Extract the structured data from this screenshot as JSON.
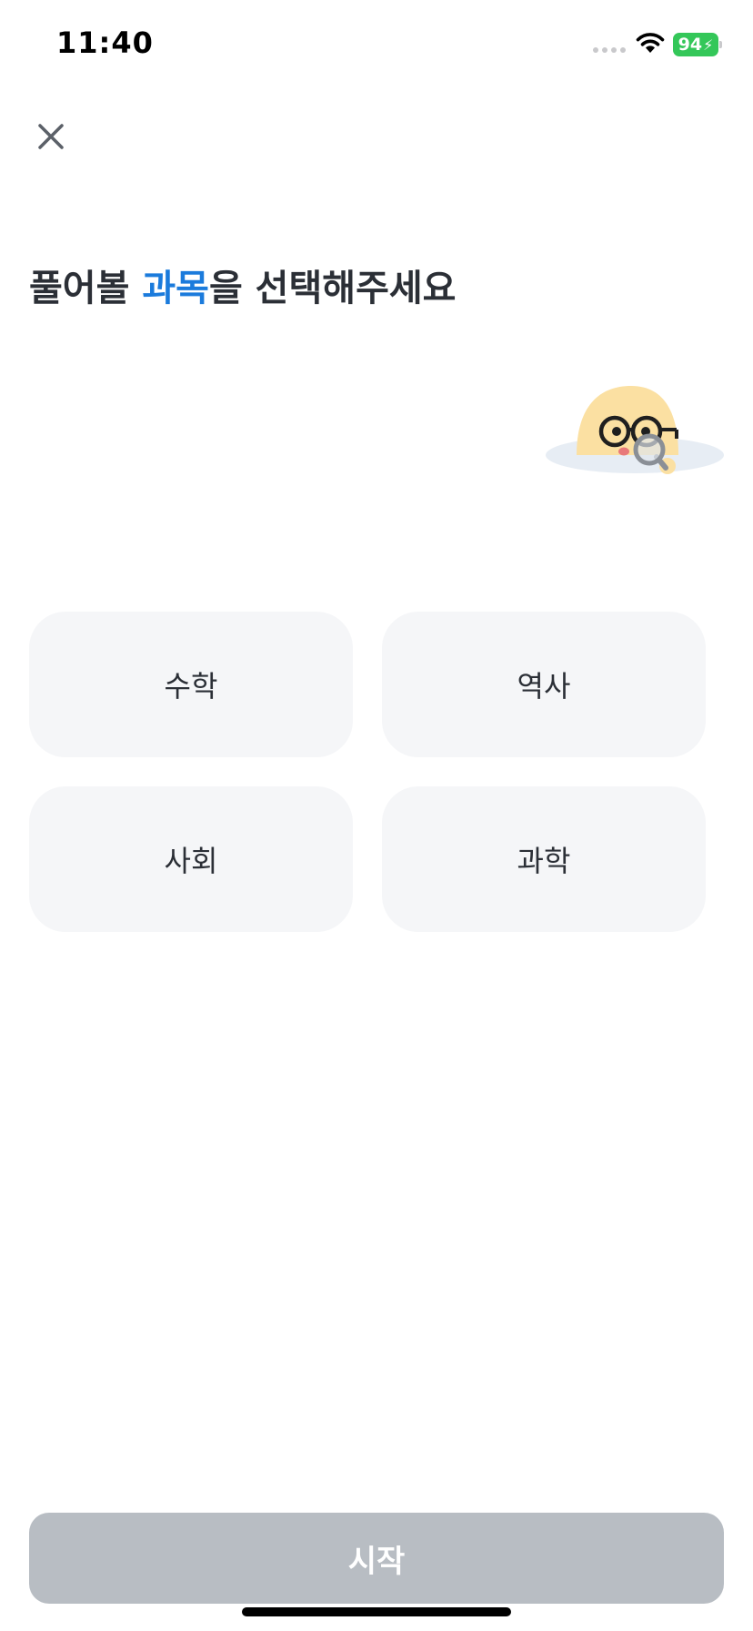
{
  "status_bar": {
    "time": "11:40",
    "battery_level": "94",
    "battery_color": "#34c759",
    "icons": [
      "signal-dots-icon",
      "wifi-icon",
      "battery-charging-icon"
    ]
  },
  "header": {
    "close_icon": "close-icon"
  },
  "heading": {
    "prefix": "풀어볼 ",
    "highlight": "과목",
    "suffix": "을 선택해주세요",
    "accent_color": "#1b7bdc"
  },
  "mascot": {
    "icon": "mascot-magnifier-icon"
  },
  "subjects": [
    {
      "label": "수학"
    },
    {
      "label": "역사"
    },
    {
      "label": "사회"
    },
    {
      "label": "과학"
    }
  ],
  "footer": {
    "start_label": "시작",
    "start_color": "#b8bdc3"
  }
}
